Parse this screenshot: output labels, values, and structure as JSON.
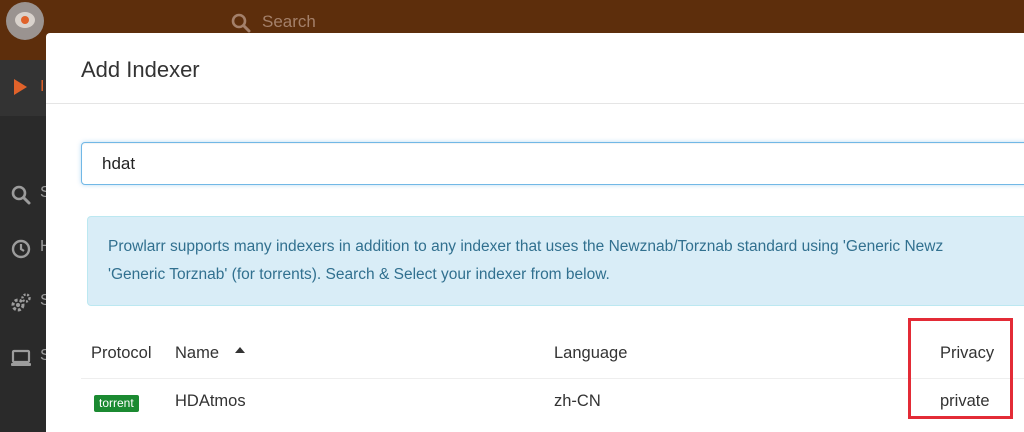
{
  "colors": {
    "header_bg": "#5d2e0c",
    "sidebar_bg": "#2a2a2a",
    "accent_orange": "#e0622a",
    "alert_bg": "#d9edf7",
    "alert_text": "#31708f",
    "badge_green": "#1b8a31",
    "highlight_red": "#e32b36"
  },
  "header": {
    "search_placeholder": "Search",
    "logo_icon": "prowlarr-logo-icon"
  },
  "sidebar": {
    "items": [
      {
        "icon": "play-icon",
        "label_fragment": "I"
      },
      {
        "icon": "search-icon",
        "label_fragment": "S"
      },
      {
        "icon": "history-icon",
        "label_fragment": "H"
      },
      {
        "icon": "settings-icon",
        "label_fragment": "S"
      },
      {
        "icon": "system-icon",
        "label_fragment": "S"
      }
    ]
  },
  "modal": {
    "title": "Add Indexer",
    "filter_value": "hdat",
    "alert_line1": "Prowlarr supports many indexers in addition to any indexer that uses the Newznab/Torznab standard using 'Generic Newz",
    "alert_line2": "'Generic Torznab' (for torrents). Search & Select your indexer from below.",
    "table": {
      "columns": {
        "protocol": "Protocol",
        "name": "Name",
        "language": "Language",
        "privacy": "Privacy"
      },
      "sort_icon": "sort-ascending-icon",
      "rows": [
        {
          "protocol": "torrent",
          "name": "HDAtmos",
          "language": "zh-CN",
          "privacy": "private"
        }
      ]
    }
  }
}
